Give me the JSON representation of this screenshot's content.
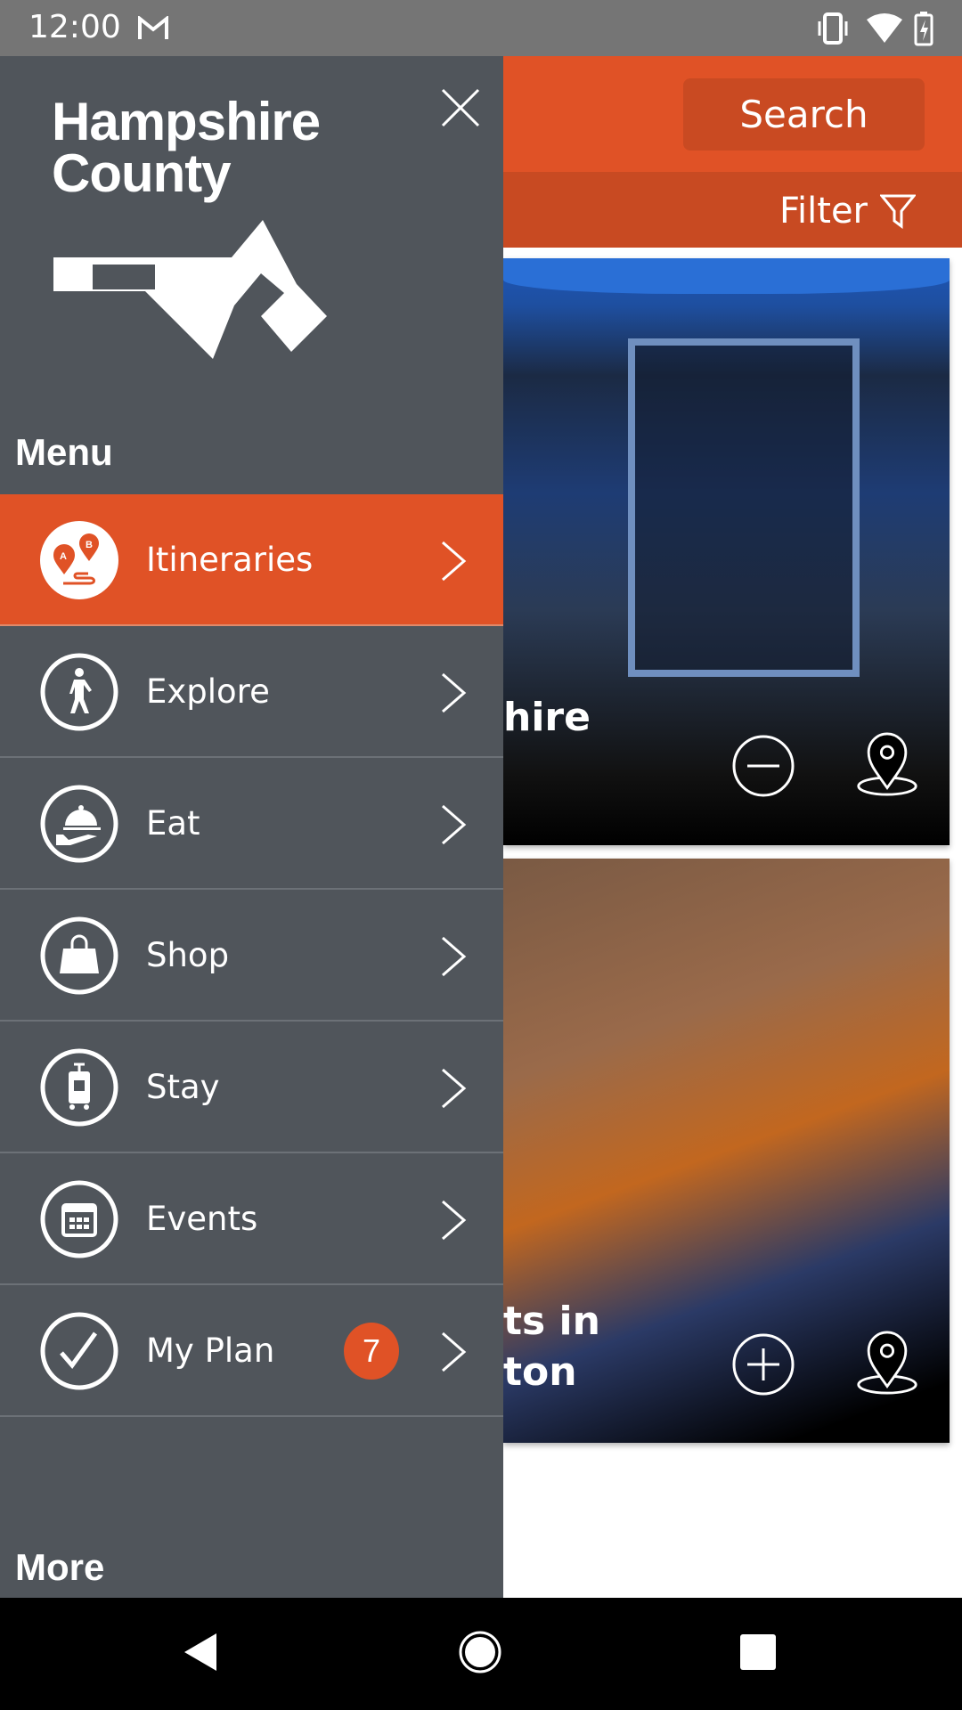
{
  "status_bar": {
    "time": "12:00",
    "icons": [
      "gmail-icon",
      "vibrate-icon",
      "wifi-icon",
      "battery-charging-icon"
    ]
  },
  "header": {
    "search_label": "Search",
    "filter_label": "Filter"
  },
  "cards": [
    {
      "title_fragment": "hire",
      "action": "remove",
      "image": "Broadside Bookshop storefront"
    },
    {
      "title_line1": "ts in",
      "title_line2": "ton",
      "action": "add"
    }
  ],
  "drawer": {
    "logo_line1": "Hampshire",
    "logo_line2": "County",
    "menu_heading": "Menu",
    "items": [
      {
        "label": "Itineraries",
        "icon": "itinerary-icon",
        "active": true
      },
      {
        "label": "Explore",
        "icon": "walking-person-icon"
      },
      {
        "label": "Eat",
        "icon": "serving-cloche-icon"
      },
      {
        "label": "Shop",
        "icon": "shopping-bag-icon"
      },
      {
        "label": "Stay",
        "icon": "luggage-icon"
      },
      {
        "label": "Events",
        "icon": "calendar-icon"
      },
      {
        "label": "My Plan",
        "icon": "checkmark-icon",
        "badge": "7"
      }
    ],
    "more_heading": "More"
  },
  "colors": {
    "accent": "#e05226",
    "drawer": "#50555b",
    "accent_dark": "#c84a22"
  }
}
